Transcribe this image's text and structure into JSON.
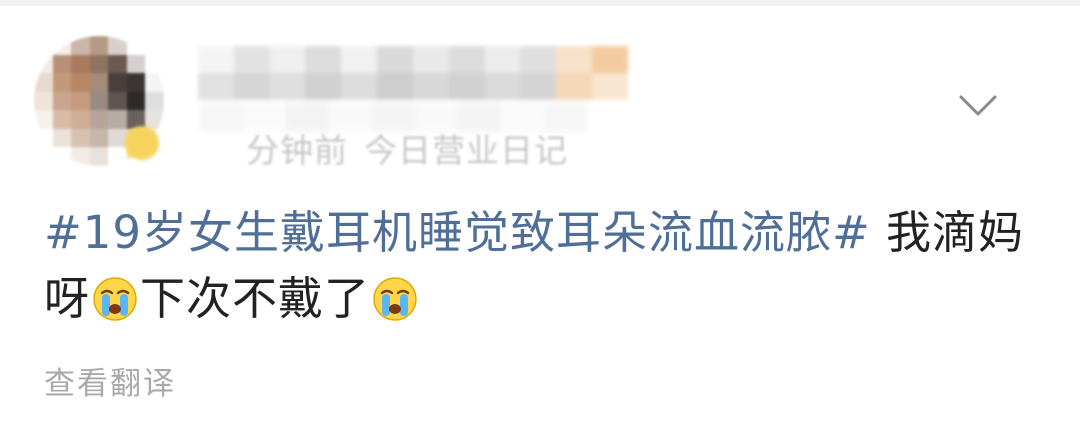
{
  "post": {
    "meta": {
      "time": "分钟前",
      "source": "今日营业日记"
    },
    "content": {
      "hashtag": "#19岁女生戴耳机睡觉致耳朵流血流脓#",
      "text_part1": " 我滴妈",
      "text_part2": "呀",
      "text_part3": "下次不戴了",
      "emoji_name": "crying-face-icon"
    },
    "translate_label": "查看翻译",
    "menu_icon": "chevron-down-icon"
  },
  "colors": {
    "hashtag": "#4f6f99",
    "body_text": "#222222",
    "muted_text": "#a9a9a9",
    "background": "#ffffff"
  }
}
